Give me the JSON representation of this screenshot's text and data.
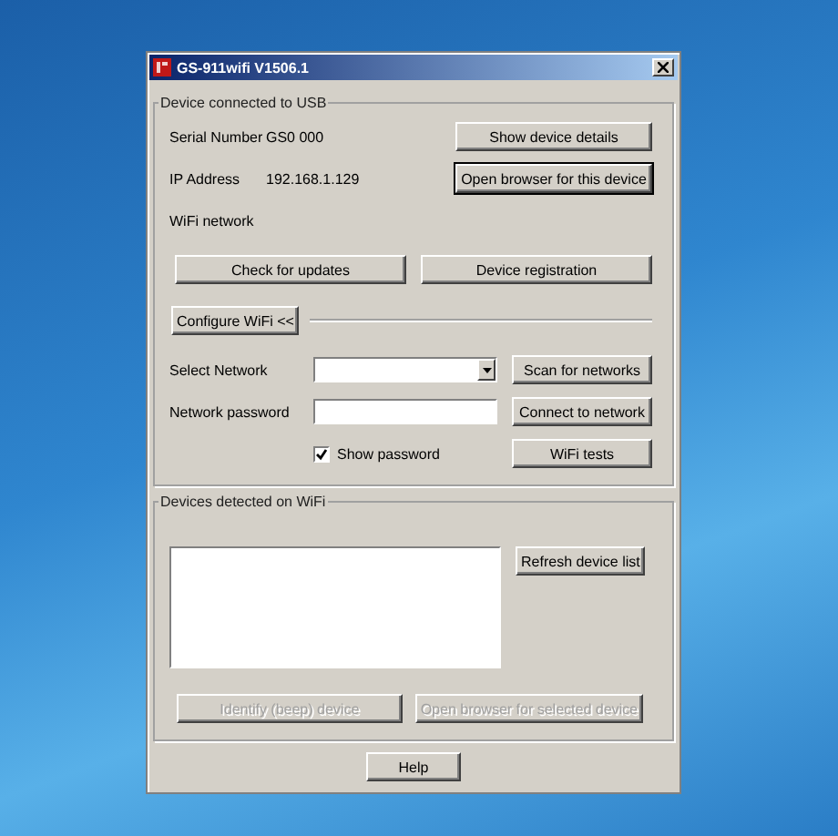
{
  "window": {
    "title": "GS-911wifi V1506.1"
  },
  "usb_device": {
    "legend": "Device connected to USB",
    "info": [
      {
        "label": "Serial Number",
        "value": "GS0 000",
        "button": {
          "label": "Show device details",
          "default": false
        }
      },
      {
        "label": "IP Address",
        "value": "192.168.1.129",
        "button": {
          "label": "Open browser for this device",
          "default": true
        }
      },
      {
        "label": "WiFi network"
      }
    ],
    "actions": [
      {
        "label": "Check for updates"
      },
      {
        "label": "Device registration"
      }
    ]
  },
  "wifi_config": {
    "toggle": "Configure WiFi <<",
    "network": {
      "label": "Select Network",
      "button": "Scan for networks"
    },
    "password": {
      "label": "Network password",
      "button": "Connect to network"
    },
    "show_password": {
      "label": "Show password",
      "checked": true
    },
    "tests_button": "WiFi tests"
  },
  "wifi_devices": {
    "legend": "Devices detected on WiFi",
    "refresh": "Refresh device list",
    "actions": [
      {
        "label": "Identify (beep) device",
        "disabled": true
      },
      {
        "label": "Open browser for selected device",
        "disabled": true
      }
    ]
  },
  "help": "Help"
}
